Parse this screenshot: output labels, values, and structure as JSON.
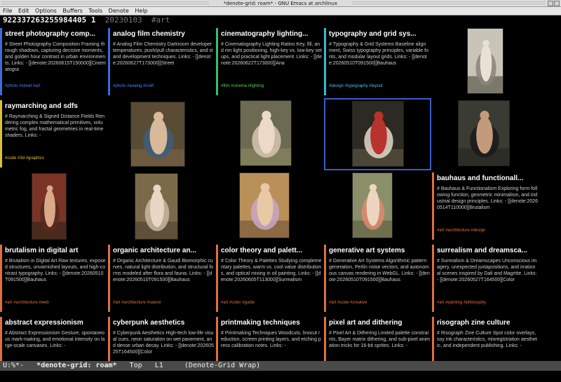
{
  "window": {
    "title": "*denote-grid: roam* - GNU Emacs at archlinux"
  },
  "menubar": [
    "File",
    "Edit",
    "Options",
    "Buffers",
    "Tools",
    "Denote",
    "Help"
  ],
  "header": {
    "id": "922337263255984405 1",
    "date": "20230103",
    "tag": "#art"
  },
  "colors": {
    "blue": "#3d6bd8",
    "green": "#3fb96f",
    "cyan": "#35b9d6",
    "yellow": "#d9c23a",
    "orange": "#e06f3f",
    "tag_blue": "#4b84e8",
    "tag_green": "#59d05a",
    "tag_cyan": "#4cc1e0",
    "tag_yellow": "#e1c532",
    "tag_orange": "#e4703c",
    "selection": "#3b5dc9"
  },
  "notes": [
    {
      "id": "street",
      "title": "street photography comp...",
      "color": "blue",
      "tagcolor": "tag_blue",
      "body": "# Street Photography Composition Framing through shadows, capturing decisive moments, and golden hour contrast in urban environments. Links: - [[denote:20260615T150000][Cinematogra",
      "tags": "#photo #street #art"
    },
    {
      "id": "analog",
      "title": "analog film chemistry",
      "color": "blue",
      "tagcolor": "tag_blue",
      "body": "# Analog Film Chemistry Darkroom developer temperatures, push/pull characteristics, and stand development techniques. Links: - [[denote:20260627T173000][Street",
      "tags": "#photo #analog #craft"
    },
    {
      "id": "cinema",
      "title": "cinematography lighting...",
      "color": "green",
      "tagcolor": "tag_green",
      "body": "# Cinematography Lighting Ratios Key, fill, and rim light positioning, high-key vs. low-key setups, and practical light placement. Links: - [[denote:20260622T173000][Ana",
      "tags": "#film #cinema #lighting"
    },
    {
      "id": "typo",
      "title": "typography and grid sys...",
      "color": "cyan",
      "tagcolor": "tag_cyan",
      "body": "# Typography & Grid Systems Baseline alignment, Swiss typography principles, variable fonts, and modular layout grids. Links: - [[denote:20260510T091500][Bauhaus",
      "tags": "#design #typography #layout"
    },
    {
      "id": "ray",
      "title": "raymarching and sdfs",
      "color": "yellow",
      "tagcolor": "tag_yellow",
      "body": "# Raymarching & Signed Distance Fields Rendering complex mathematical primitives, volumetric fog, and fractal geometries in real-time shaders. Links: -",
      "tags": "#code #3d #graphics"
    },
    {
      "id": "bauhaus",
      "title": "bauhaus and functionall...",
      "color": "orange",
      "tagcolor": "tag_orange",
      "body": "# Bauhaus & Functionalism Exploring form following function, geometric minimalism, and industrial design principles. Links: - [[denote:20260514T110000][Brutalism",
      "tags": "#art #architecture #design"
    },
    {
      "id": "brutal",
      "title": "brutalism in digital art",
      "color": "orange",
      "tagcolor": "tag_orange",
      "body": "# Brutalism in Digital Art Raw textures, exposed structures, unvarnished layouts, and high-contrast typography. Links: - [[denote:20260510T091500][Bauhaus",
      "tags": "#art #architecture #web"
    },
    {
      "id": "organic",
      "title": "organic architecture an...",
      "color": "orange",
      "tagcolor": "tag_orange",
      "body": "# Organic Architecture & Gaudi Biomorphic curves, natural light distribution, and structural forms modeled after flora and fauna. Links: - [[denote:20260510T091500][Bauhaus",
      "tags": "#art #architecture #nature"
    },
    {
      "id": "color",
      "title": "color theory and palett...",
      "color": "orange",
      "tagcolor": "tag_orange",
      "body": "# Color Theory & Palettes Studying complementary palettes, warm vs. cool value distributions, and optical mixing in oil painting. Links: - [[denote:20260605T113000][Surrealism",
      "tags": "#art #color #guide"
    },
    {
      "id": "genart",
      "title": "generative art systems",
      "color": "orange",
      "tagcolor": "tag_orange",
      "body": "# Generative Art Systems Algorithmic pattern generation, Perlin noise vectors, and autonomous canvas rendering in WebGL. Links: - [[denote:20260510T091500][Bauhaus",
      "tags": "#art #code #creative"
    },
    {
      "id": "surreal",
      "title": "surrealism and dreamsca...",
      "color": "orange",
      "tagcolor": "tag_orange",
      "body": "# Surrealism & Dreamscapes Unconscious imagery, unexpected juxtapositions, and irrational scenes inspired by Dali and Magritte. Links: - [[denote:20260527T164500][Color",
      "tags": "#art #painting #philosophy"
    },
    {
      "id": "abstract",
      "title": "abstract expressionism",
      "color": "orange",
      "tagcolor": "tag_orange",
      "body": "# Abstract Expressionism Gesture, spontaneous mark-making, and emotional intensity on large-scale canvases. Links: -",
      "tags": ""
    },
    {
      "id": "cyber",
      "title": "cyberpunk aesthetics",
      "color": "orange",
      "tagcolor": "tag_orange",
      "body": "# Cyberpunk Aesthetics High-tech low-life visual cues, neon saturation on wet pavement, and dense urban decay. Links: - [[denote:20260525T164500][Color",
      "tags": ""
    },
    {
      "id": "print",
      "title": "printmaking techniques",
      "color": "orange",
      "tagcolor": "tag_orange",
      "body": "# Printmaking Techniques Woodcuts, linocut reduction, screen printing layers, and etching press calibration notes. Links: -",
      "tags": ""
    },
    {
      "id": "pixel",
      "title": "pixel art and dithering",
      "color": "orange",
      "tagcolor": "tag_orange",
      "body": "# Pixel Art & Dithering Limited palette constraints, Bayer matrix dithering, and sub-pixel animation tricks for 16-bit sprites. Links: -",
      "tags": ""
    },
    {
      "id": "riso",
      "title": "risograph zine culture",
      "color": "orange",
      "tagcolor": "tag_orange",
      "body": "# Risograph Zine Culture Spot color overlays, soy ink characteristics, misregistration aesthetic, and independent publishing. Links: -",
      "tags": ""
    }
  ],
  "paintings": [
    {
      "id": "p1",
      "sky": "#c9c4b8",
      "fig": "#e8e2d4",
      "acc": "#8a8578",
      "ground": "#7b7a6a"
    },
    {
      "id": "p2",
      "sky": "#5a4b35",
      "fig": "#d8b99a",
      "acc": "#3d5e7a",
      "ground": "#6e5b3f"
    },
    {
      "id": "p3",
      "sky": "#6c6a52",
      "fig": "#ecd9c8",
      "acc": "#d6c7b2",
      "ground": "#7f7d5a"
    },
    {
      "id": "p4",
      "sky": "#2c2a22",
      "fig": "#b8322e",
      "acc": "#e5d9c9",
      "ground": "#4c4638"
    },
    {
      "id": "p5",
      "sky": "#3a3b33",
      "fig": "#c49a7c",
      "acc": "#1a1a1a",
      "ground": "#2c2d26"
    },
    {
      "id": "p6",
      "sky": "#7a3426",
      "fig": "#d9a98a",
      "acc": "#5b2a20",
      "ground": "#4a2a1c"
    },
    {
      "id": "p7",
      "sky": "#7a6a4a",
      "fig": "#ead7c3",
      "acc": "#c9b7a3",
      "ground": "#5f503a"
    },
    {
      "id": "p8",
      "sky": "#b99058",
      "fig": "#e7c9a4",
      "acc": "#c9a7c8",
      "ground": "#8b6a44"
    },
    {
      "id": "p9",
      "sky": "#8a8f6a",
      "fig": "#ecd6c0",
      "acc": "#e08a6e",
      "ground": "#6e6f4e"
    }
  ],
  "modeline": {
    "status": "U:%*-",
    "buffer": "*denote-grid: roam*",
    "position": "Top",
    "line": "L1",
    "mode": "(Denote-Grid Wrap)"
  }
}
